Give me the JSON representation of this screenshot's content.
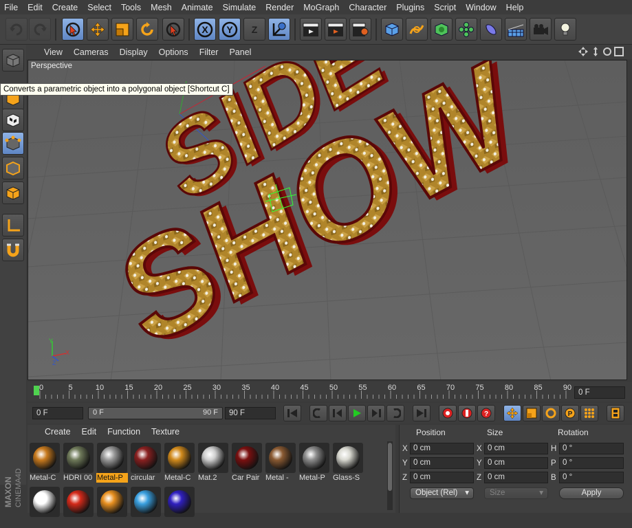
{
  "menubar": [
    "File",
    "Edit",
    "Create",
    "Select",
    "Tools",
    "Mesh",
    "Animate",
    "Simulate",
    "Render",
    "MoGraph",
    "Character",
    "Plugins",
    "Script",
    "Window",
    "Help"
  ],
  "toolbar": {
    "icons": [
      "undo-icon",
      "redo-icon",
      "live-selection-icon",
      "move-icon",
      "scale-icon",
      "rotate-icon",
      "last-tool-icon",
      "x-axis-icon",
      "y-axis-icon",
      "z-axis-icon",
      "world-coords-icon",
      "render-view-icon",
      "render-picture-viewer-icon",
      "edit-render-settings-icon",
      "cube-icon",
      "spline-pen-icon",
      "subdivision-surface-icon",
      "array-icon",
      "deformer-icon",
      "floor-icon",
      "camera-icon",
      "light-icon"
    ],
    "axis_x": "X",
    "axis_y": "Y",
    "axis_z": "Z"
  },
  "viewport": {
    "menu": [
      "View",
      "Cameras",
      "Display",
      "Options",
      "Filter",
      "Panel"
    ],
    "label": "Perspective",
    "scene_text_line1": "SIDE",
    "scene_text_line2": "SHOW",
    "tooltip": "Converts a parametric object into a polygonal object [Shortcut C]",
    "axis_x": "X",
    "axis_y": "Y",
    "axis_z": "Z"
  },
  "timeline": {
    "ticks": [
      "0",
      "5",
      "10",
      "15",
      "20",
      "25",
      "30",
      "35",
      "40",
      "45",
      "50",
      "55",
      "60",
      "65",
      "70",
      "75",
      "80",
      "85",
      "90"
    ],
    "current_frame": "0 F"
  },
  "transport": {
    "start_frame": "0 F",
    "range_start": "0 F",
    "range_end": "90 F",
    "end_frame": "90 F"
  },
  "materials": {
    "menu": [
      "Create",
      "Edit",
      "Function",
      "Texture"
    ],
    "items": [
      {
        "label": "Metal-C",
        "color": "#c87a1e"
      },
      {
        "label": "HDRI 00",
        "color": "#6f7a5a"
      },
      {
        "label": "Metal-P",
        "color": "#9a9a9a",
        "selected": true
      },
      {
        "label": "circular",
        "color": "#8a2020"
      },
      {
        "label": "Metal-C",
        "color": "#d18a1c"
      },
      {
        "label": "Mat.2",
        "color": "#cfcfcf"
      },
      {
        "label": "Car Pair",
        "color": "#7a1010"
      },
      {
        "label": "Metal -",
        "color": "#8a5a32"
      },
      {
        "label": "Metal-P",
        "color": "#8c8c8c"
      },
      {
        "label": "Glass-S",
        "color": "#d8d8d0"
      }
    ],
    "row2_colors": [
      "#ffffff",
      "#d42a1a",
      "#e89020",
      "#3aa0e0",
      "#3020c0"
    ]
  },
  "coords": {
    "headers": [
      "Position",
      "Size",
      "Rotation"
    ],
    "rows": [
      {
        "a1": "X",
        "v1": "0 cm",
        "a2": "X",
        "v2": "0 cm",
        "a3": "H",
        "v3": "0 °"
      },
      {
        "a1": "Y",
        "v1": "0 cm",
        "a2": "Y",
        "v2": "0 cm",
        "a3": "P",
        "v3": "0 °"
      },
      {
        "a1": "Z",
        "v1": "0 cm",
        "a2": "Z",
        "v2": "0 cm",
        "a3": "B",
        "v3": "0 °"
      }
    ],
    "mode": "Object (Rel)",
    "size_mode": "Size",
    "apply": "Apply"
  },
  "brand": {
    "line1": "MAXON",
    "line2": "CINEMA4D"
  }
}
